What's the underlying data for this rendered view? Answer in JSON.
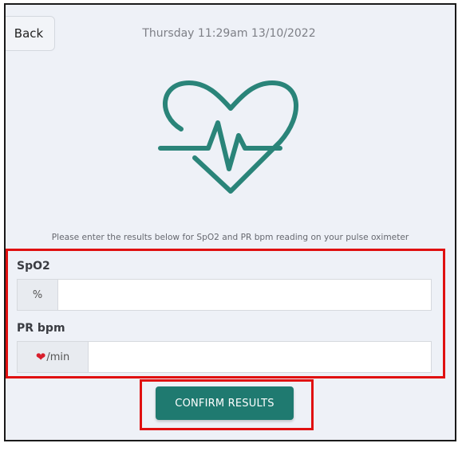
{
  "header": {
    "back_label": "Back",
    "timestamp": "Thursday 11:29am 13/10/2022"
  },
  "hero": {
    "icon": "heart-pulse-icon",
    "color": "#2a8479"
  },
  "instruction": "Please enter the results below for SpO2 and PR bpm reading on your pulse oximeter",
  "form": {
    "spo2": {
      "label": "SpO2",
      "unit": "%",
      "value": "",
      "placeholder": ""
    },
    "pr": {
      "label": "PR bpm",
      "unit_icon": "heart-icon",
      "unit": "/min",
      "value": "",
      "placeholder": ""
    }
  },
  "confirm": {
    "label": "CONFIRM RESULTS",
    "color": "#1f7a70"
  },
  "annotation": {
    "color": "#e01010"
  }
}
